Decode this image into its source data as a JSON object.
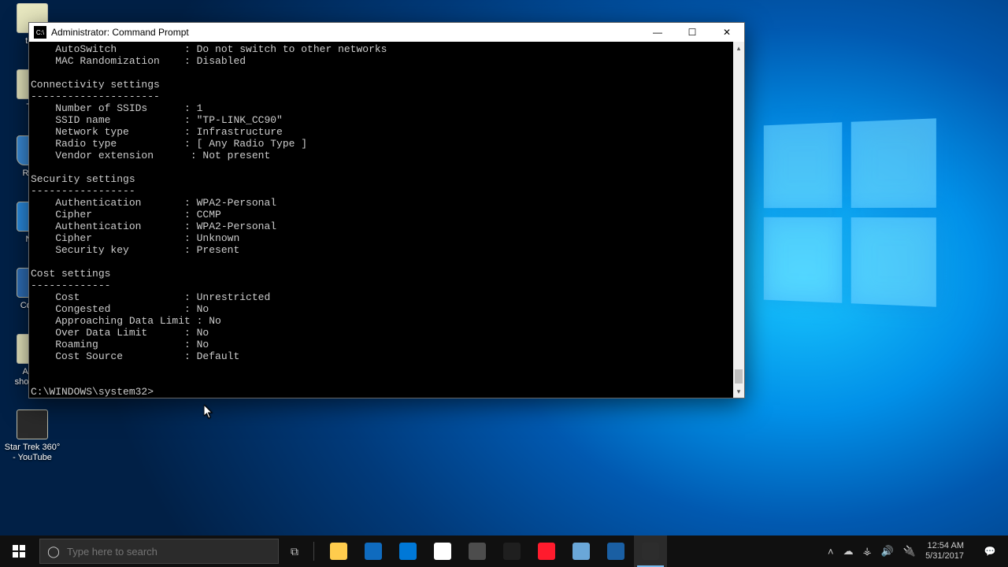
{
  "desktop_icons": [
    {
      "name": "tige",
      "label": "tige",
      "glyph": "app"
    },
    {
      "name": "thi",
      "label": "Thi",
      "glyph": "app"
    },
    {
      "name": "recy",
      "label": "Recy",
      "glyph": "bin"
    },
    {
      "name": "net",
      "label": "Net",
      "glyph": "net"
    },
    {
      "name": "cp",
      "label": "Co\nPa",
      "glyph": "cp"
    },
    {
      "name": "apps",
      "label": "Apps shortcuts",
      "glyph": "app"
    },
    {
      "name": "trek",
      "label": "Star Trek 360° - YouTube",
      "glyph": "trek"
    }
  ],
  "cmd_window": {
    "title": "Administrator: Command Prompt",
    "icon_text": "C:\\",
    "buttons": {
      "min": "—",
      "max": "☐",
      "close": "✕"
    },
    "scroll_up": "▴",
    "scroll_down": "▾",
    "lines": [
      "    AutoSwitch           : Do not switch to other networks",
      "    MAC Randomization    : Disabled",
      "",
      "Connectivity settings",
      "---------------------",
      "    Number of SSIDs      : 1",
      "    SSID name            : \"TP-LINK_CC90\"",
      "    Network type         : Infrastructure",
      "    Radio type           : [ Any Radio Type ]",
      "    Vendor extension      : Not present",
      "",
      "Security settings",
      "-----------------",
      "    Authentication       : WPA2-Personal",
      "    Cipher               : CCMP",
      "    Authentication       : WPA2-Personal",
      "    Cipher               : Unknown",
      "    Security key         : Present",
      "",
      "Cost settings",
      "-------------",
      "    Cost                 : Unrestricted",
      "    Congested            : No",
      "    Approaching Data Limit : No",
      "    Over Data Limit      : No",
      "    Roaming              : No",
      "    Cost Source          : Default",
      "",
      "",
      "C:\\WINDOWS\\system32>"
    ]
  },
  "taskbar": {
    "search_placeholder": "Type here to search",
    "pinned": [
      {
        "name": "file-explorer",
        "bg": "#ffcc4d"
      },
      {
        "name": "mail",
        "bg": "#0f6bbf"
      },
      {
        "name": "edge",
        "bg": "#0078d7"
      },
      {
        "name": "chrome",
        "bg": "#ffffff"
      },
      {
        "name": "settings",
        "bg": "#4d4d4d"
      },
      {
        "name": "store",
        "bg": "#1f1f1f"
      },
      {
        "name": "opera",
        "bg": "#ff1b2d"
      },
      {
        "name": "misc1",
        "bg": "#6aa7d8"
      },
      {
        "name": "photos",
        "bg": "#1a5fa3"
      },
      {
        "name": "cmd",
        "bg": "#2d2d2d",
        "active": true
      }
    ],
    "tray": {
      "up": "˄",
      "onedrive": "☁",
      "wifi": "⚶",
      "sound": "🔊",
      "power": "🔌",
      "time": "12:54 AM",
      "date": "5/31/2017",
      "notif": "💬"
    }
  }
}
